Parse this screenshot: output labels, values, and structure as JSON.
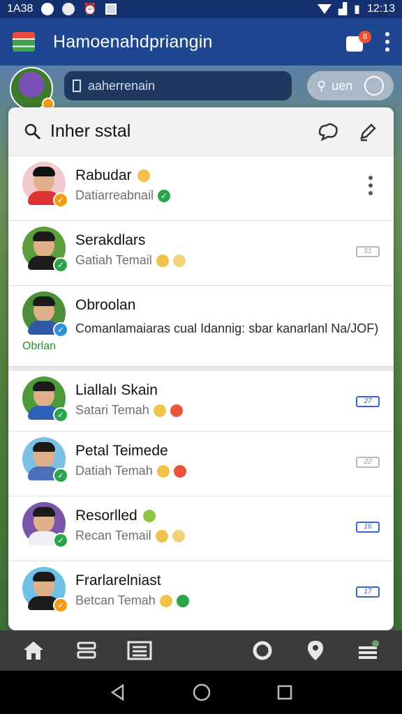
{
  "status_bar": {
    "time_left": "1A38",
    "time_right": "12:13"
  },
  "app_bar": {
    "title": "Hamoenahdpriangin",
    "notification_count": "8"
  },
  "top_search": {
    "text": "aaherrenain",
    "pill_text": "uen"
  },
  "search": {
    "label": "Inher sstal"
  },
  "chats": [
    {
      "name": "Rabudar",
      "subtitle": "Datiarreabnail",
      "status": "orange",
      "tag": ""
    },
    {
      "name": "Serakdlars",
      "subtitle": "Gatiah Temail",
      "status": "green",
      "tag": "51"
    },
    {
      "name": "Obroolan",
      "message": "Comanlamaiaras cual Idannig: sbar kanarlanl Na/JOF)",
      "avatar_label": "Obrlan",
      "status": "blue",
      "tag": ""
    },
    {
      "name": "Liallalı Skain",
      "subtitle": "Satari Temah",
      "status": "green",
      "tag": "27"
    },
    {
      "name": "Petal Teimede",
      "subtitle": "Datiah Temah",
      "status": "green",
      "tag": "22"
    },
    {
      "name": "Resorlled",
      "subtitle": "Recan Temail",
      "status": "green",
      "tag": "16"
    },
    {
      "name": "Frarlarelniast",
      "subtitle": "Betcan Temah",
      "status": "orange",
      "tag": "17"
    }
  ],
  "colors": {
    "app_bar": "#1f4690",
    "status_bar": "#15306e",
    "online": "#2aa64a",
    "away": "#f39c12",
    "verified": "#2f8fd8",
    "bottom_nav": "#3a3b3d"
  }
}
